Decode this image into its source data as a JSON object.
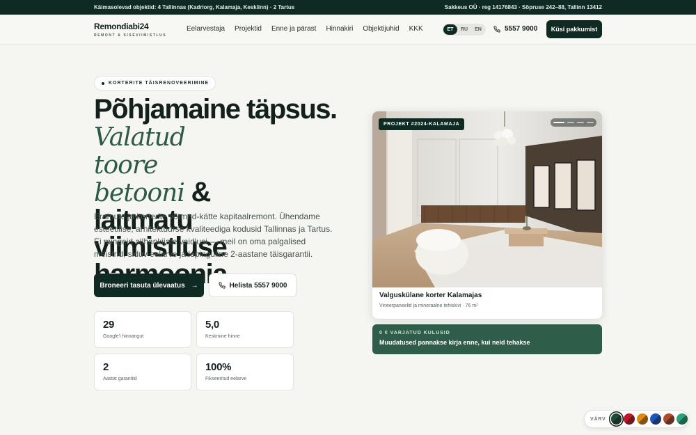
{
  "topbar": {
    "left": "Käimasolevad objektid: 4 Tallinnas (Kadriorg, Kalamaja, Kesklinn) · 2 Tartus",
    "right": "Sakkeus OÜ · reg 14176843 · Sõpruse 242–88, Tallinn 13412"
  },
  "nav": {
    "logo_name": "Remondiabi24",
    "logo_tagline": "REMONT & SISEVIIMISTLUS",
    "items": [
      "Eelarvestaja",
      "Projektid",
      "Enne ja pärast",
      "Hinnakiri",
      "Objektijuhid",
      "KKK"
    ],
    "languages": [
      "ET",
      "RU",
      "EN"
    ],
    "active_language": "ET",
    "phone": "5557 9000",
    "cta": "Küsi pakkumist"
  },
  "hero": {
    "pill": "KORTERITE TÄISRENOVEERIMINE",
    "headline_line1": "Põhjamaine täpsus.",
    "headline_italic": "Valatud toore betooni",
    "headline_line3": "& laitmatu",
    "headline_line4": "viimistluse harmoonia.",
    "lead": "Eramute ja korterite võtmed-kätte kapitaalremont. Ühendame esteetilise, arhitektuurse kvaliteediga kodusid Tallinnas ja Tartus. Ei mingeid allhankijate vaidlusi — meil on oma palgalised meistrid, siduv eelarve ja lepinguline 2-aastane täisgarantii.",
    "primary_button": "Broneeri tasuta ülevaatus",
    "secondary_button": "Helista 5557 9000"
  },
  "stats": [
    {
      "value": "29",
      "label": "Google'i hinnangut"
    },
    {
      "value": "5,0",
      "label": "Keskmine hinne"
    },
    {
      "value": "2",
      "label": "Aastat garantiid"
    },
    {
      "value": "100%",
      "label": "Fikseeritud eelarve"
    }
  ],
  "project_card": {
    "badge": "PROJEKT #2024-KALAMAJA",
    "title": "Valguskülane korter Kalamajas",
    "subtitle": "Vineerpaneelid ja mineraalne tehiskivi · 76 m²",
    "slides": 4,
    "active_slide": 1
  },
  "notice": {
    "kicker": "0 € VARJATUD KULUSID",
    "text": "Muudatused pannakse kirja enne, kui neid tehakse"
  },
  "color_picker": {
    "label": "VÄRV",
    "swatches": [
      "#1f4a3a",
      "#c0182b",
      "#e08a12",
      "#1f57b8",
      "#b04a2a",
      "#2aa37a"
    ],
    "selected": 0
  }
}
